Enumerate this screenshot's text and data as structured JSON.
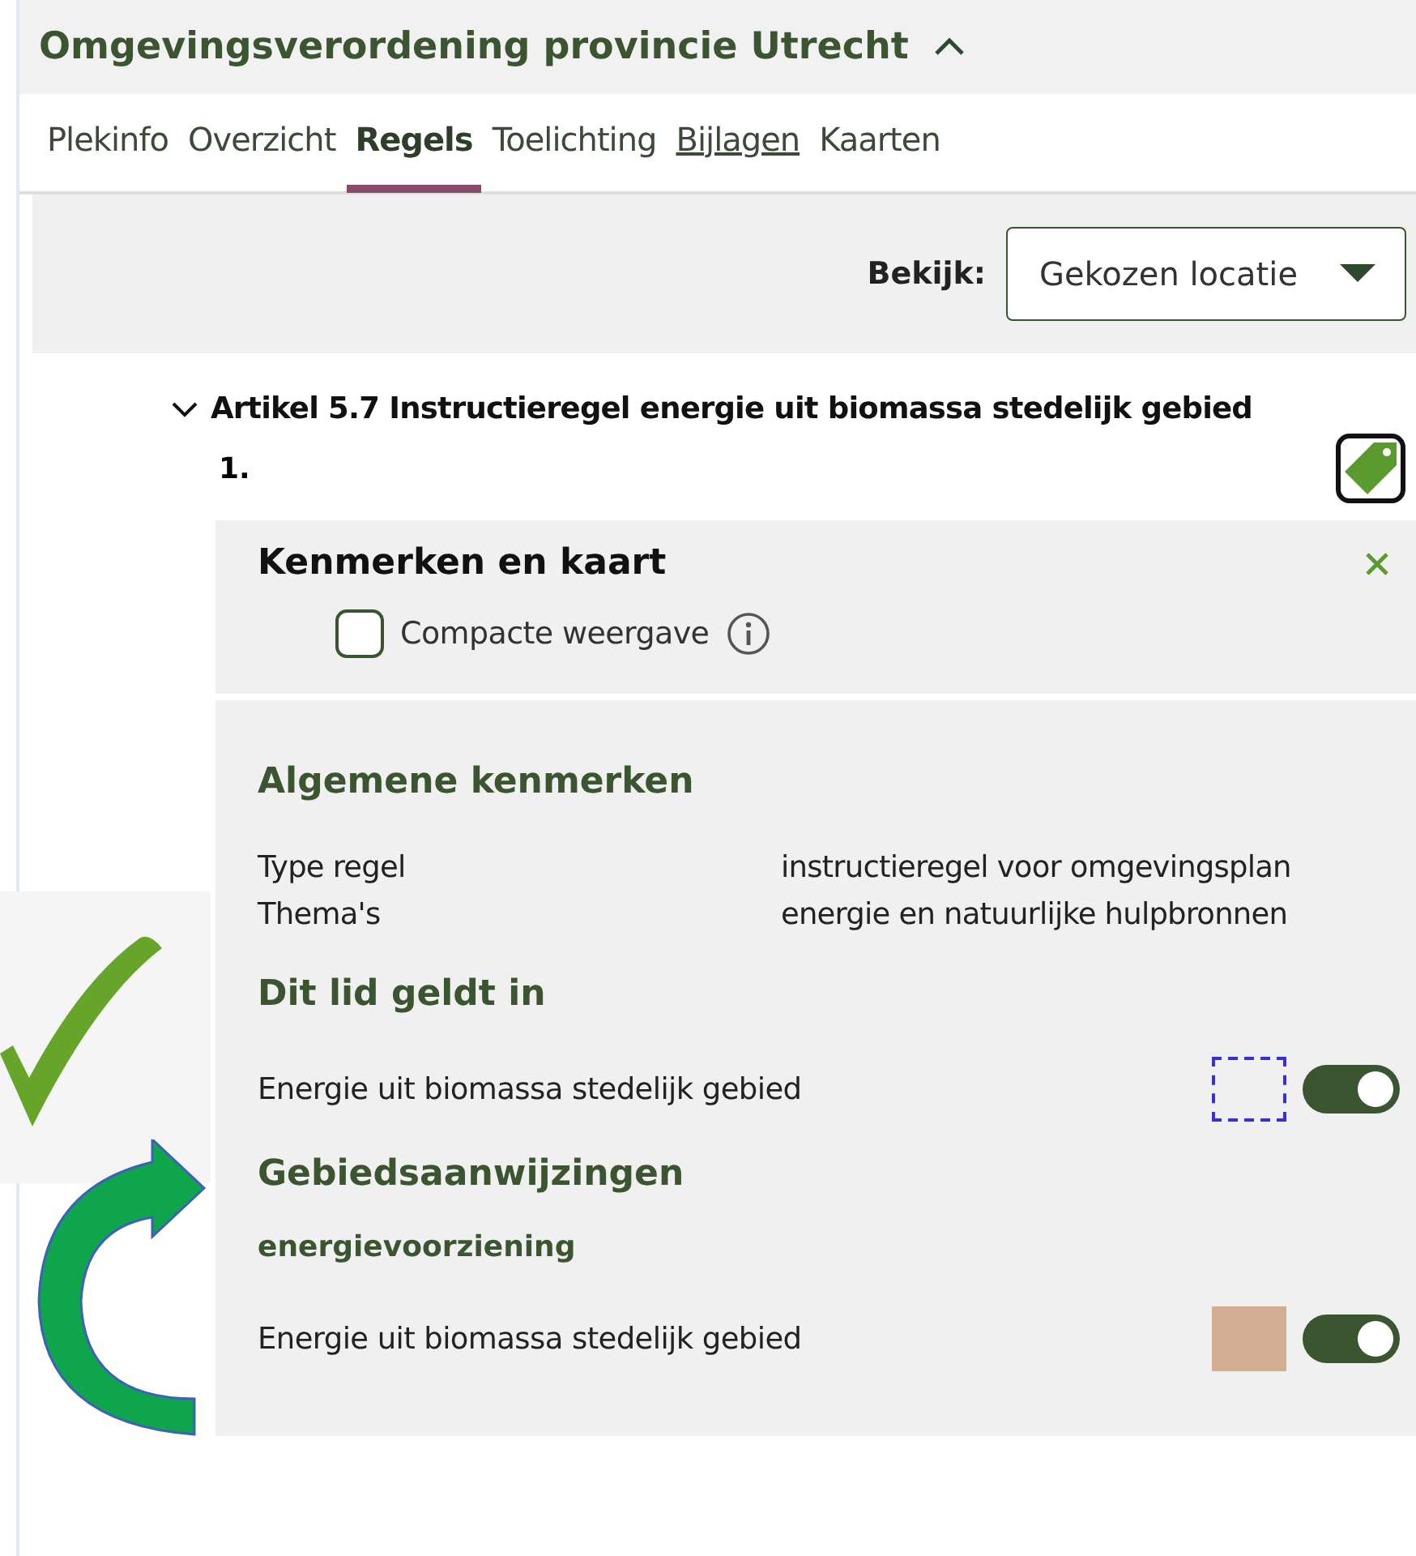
{
  "header": {
    "title": "Omgevingsverordening provincie Utrecht",
    "expanded": true
  },
  "tabs": [
    {
      "label": "Plekinfo",
      "selected": false,
      "hovered": false
    },
    {
      "label": "Overzicht",
      "selected": false,
      "hovered": false
    },
    {
      "label": "Regels",
      "selected": true,
      "hovered": false
    },
    {
      "label": "Toelichting",
      "selected": false,
      "hovered": false
    },
    {
      "label": "Bijlagen",
      "selected": false,
      "hovered": true
    },
    {
      "label": "Kaarten",
      "selected": false,
      "hovered": false
    }
  ],
  "toolbar": {
    "label": "Bekijk:",
    "dropdown": {
      "value": "Gekozen locatie"
    }
  },
  "article": {
    "title": "Artikel 5.7 Instructieregel energie uit biomassa stedelijk gebied",
    "expanded": true,
    "member": "1."
  },
  "panel": {
    "title": "Kenmerken en kaart",
    "compact": {
      "label": "Compacte weergave",
      "checked": false
    },
    "sections": [
      {
        "title": "Algemene kenmerken",
        "kind": "properties",
        "rows": [
          {
            "label": "Type regel",
            "value": "instructieregel voor omgevingsplan"
          },
          {
            "label": "Thema's",
            "value": "energie en natuurlijke hulpbronnen"
          }
        ]
      },
      {
        "title": "Dit lid geldt in",
        "kind": "layers",
        "groups": [
          {
            "layers": [
              {
                "label": "Energie uit biomassa stedelijk gebied",
                "kind": "outline",
                "color": "#3a2fd6",
                "on": true
              }
            ]
          }
        ]
      },
      {
        "title": "Gebiedsaanwijzingen",
        "kind": "layers",
        "groups": [
          {
            "name": "energievoorziening",
            "layers": [
              {
                "label": "Energie uit biomassa stedelijk gebied",
                "kind": "fill",
                "color": "#d3ae93",
                "on": true
              }
            ]
          }
        ]
      }
    ]
  }
}
